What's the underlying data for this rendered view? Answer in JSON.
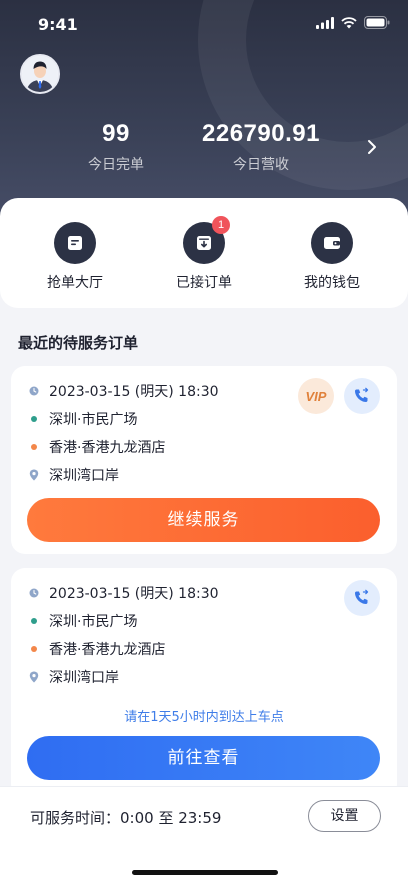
{
  "status_bar": {
    "time": "9:41"
  },
  "header": {
    "stats": [
      {
        "value": "99",
        "label": "今日完单"
      },
      {
        "value": "226790.91",
        "label": "今日营收"
      }
    ]
  },
  "quick_actions": [
    {
      "label": "抢单大厅",
      "icon": "order-hall-icon"
    },
    {
      "label": "已接订单",
      "icon": "accepted-orders-icon",
      "badge": "1"
    },
    {
      "label": "我的钱包",
      "icon": "wallet-icon"
    }
  ],
  "section_title": "最近的待服务订单",
  "orders": [
    {
      "datetime": "2023-03-15 (明天) 18:30",
      "start": "深圳·市民广场",
      "via": "香港·香港九龙酒店",
      "end": "深圳湾口岸",
      "vip": "VIP",
      "action_label": "继续服务"
    },
    {
      "datetime": "2023-03-15 (明天) 18:30",
      "start": "深圳·市民广场",
      "via": "香港·香港九龙酒店",
      "end": "深圳湾口岸",
      "hint": "请在1天5小时内到达上车点",
      "action_label": "前往查看"
    }
  ],
  "bottom": {
    "service_time": "可服务时间：0:00 至 23:59",
    "settings_label": "设置"
  },
  "colors": {
    "header_dark": "#2b3042",
    "accent_orange": "#fb5f2d",
    "accent_blue": "#2f6df2",
    "badge_red": "#f0545b"
  }
}
